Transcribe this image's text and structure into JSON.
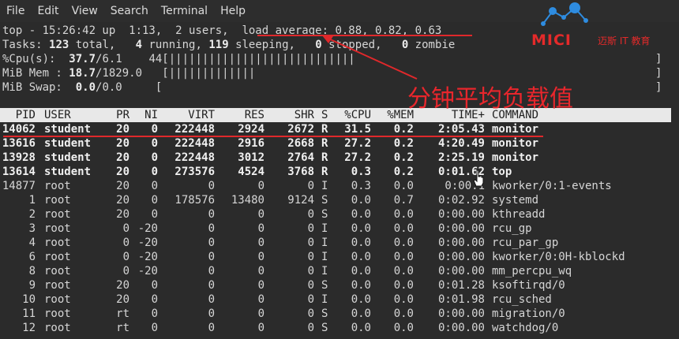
{
  "menu": [
    "File",
    "Edit",
    "View",
    "Search",
    "Terminal",
    "Help"
  ],
  "summary": {
    "top_prefix": "top - 15:26:42 up  1:13,  2 users,  ",
    "load_average": "load average: 0.88, 0.82, 0.63",
    "tasks_label": "Tasks: ",
    "tasks_total": "123",
    "tasks_total_label": " total,   ",
    "tasks_running": "4",
    "tasks_running_label": " running, ",
    "tasks_sleeping": "119",
    "tasks_sleeping_label": " sleeping,   ",
    "tasks_stopped": "0",
    "tasks_stopped_label": " stopped,   ",
    "tasks_zombie": "0",
    "tasks_zombie_label": " zombie",
    "cpu_label": "%Cpu(s):  ",
    "cpu_value": "37.7",
    "cpu_rest": "/6.1    44[||||||||||||||||||||||||||||",
    "mem_label": "MiB Mem : ",
    "mem_value": "18.7",
    "mem_rest": "/1829.0   [|||||||||||||",
    "swap_label": "MiB Swap:  ",
    "swap_value": "0.0",
    "swap_rest": "/0.0     [",
    "bracket": "]"
  },
  "columns": [
    "PID",
    "USER",
    "PR",
    "NI",
    "VIRT",
    "RES",
    "SHR",
    "S",
    "%CPU",
    "%MEM",
    "TIME+",
    "COMMAND"
  ],
  "processes": [
    {
      "pid": "14062",
      "user": "student",
      "pr": "20",
      "ni": "0",
      "virt": "222448",
      "res": "2924",
      "shr": "2672",
      "s": "R",
      "cpu": "31.5",
      "mem": "0.2",
      "time": "2:05.43",
      "cmd": "monitor",
      "bold": true
    },
    {
      "pid": "13616",
      "user": "student",
      "pr": "20",
      "ni": "0",
      "virt": "222448",
      "res": "2916",
      "shr": "2668",
      "s": "R",
      "cpu": "27.2",
      "mem": "0.2",
      "time": "4:20.49",
      "cmd": "monitor",
      "bold": true
    },
    {
      "pid": "13928",
      "user": "student",
      "pr": "20",
      "ni": "0",
      "virt": "222448",
      "res": "3012",
      "shr": "2764",
      "s": "R",
      "cpu": "27.2",
      "mem": "0.2",
      "time": "2:25.19",
      "cmd": "monitor",
      "bold": true
    },
    {
      "pid": "13614",
      "user": "student",
      "pr": "20",
      "ni": "0",
      "virt": "273576",
      "res": "4524",
      "shr": "3768",
      "s": "R",
      "cpu": "0.3",
      "mem": "0.2",
      "time": "0:01.62",
      "cmd": "top",
      "bold": true
    },
    {
      "pid": "14877",
      "user": "root",
      "pr": "20",
      "ni": "0",
      "virt": "0",
      "res": "0",
      "shr": "0",
      "s": "I",
      "cpu": "0.3",
      "mem": "0.0",
      "time": "0:00.1",
      "cmd": "kworker/0:1-events",
      "bold": false
    },
    {
      "pid": "1",
      "user": "root",
      "pr": "20",
      "ni": "0",
      "virt": "178576",
      "res": "13480",
      "shr": "9124",
      "s": "S",
      "cpu": "0.0",
      "mem": "0.7",
      "time": "0:02.92",
      "cmd": "systemd",
      "bold": false
    },
    {
      "pid": "2",
      "user": "root",
      "pr": "20",
      "ni": "0",
      "virt": "0",
      "res": "0",
      "shr": "0",
      "s": "S",
      "cpu": "0.0",
      "mem": "0.0",
      "time": "0:00.00",
      "cmd": "kthreadd",
      "bold": false
    },
    {
      "pid": "3",
      "user": "root",
      "pr": "0",
      "ni": "-20",
      "virt": "0",
      "res": "0",
      "shr": "0",
      "s": "I",
      "cpu": "0.0",
      "mem": "0.0",
      "time": "0:00.00",
      "cmd": "rcu_gp",
      "bold": false
    },
    {
      "pid": "4",
      "user": "root",
      "pr": "0",
      "ni": "-20",
      "virt": "0",
      "res": "0",
      "shr": "0",
      "s": "I",
      "cpu": "0.0",
      "mem": "0.0",
      "time": "0:00.00",
      "cmd": "rcu_par_gp",
      "bold": false
    },
    {
      "pid": "6",
      "user": "root",
      "pr": "0",
      "ni": "-20",
      "virt": "0",
      "res": "0",
      "shr": "0",
      "s": "I",
      "cpu": "0.0",
      "mem": "0.0",
      "time": "0:00.00",
      "cmd": "kworker/0:0H-kblockd",
      "bold": false
    },
    {
      "pid": "8",
      "user": "root",
      "pr": "0",
      "ni": "-20",
      "virt": "0",
      "res": "0",
      "shr": "0",
      "s": "I",
      "cpu": "0.0",
      "mem": "0.0",
      "time": "0:00.00",
      "cmd": "mm_percpu_wq",
      "bold": false
    },
    {
      "pid": "9",
      "user": "root",
      "pr": "20",
      "ni": "0",
      "virt": "0",
      "res": "0",
      "shr": "0",
      "s": "S",
      "cpu": "0.0",
      "mem": "0.0",
      "time": "0:01.28",
      "cmd": "ksoftirqd/0",
      "bold": false
    },
    {
      "pid": "10",
      "user": "root",
      "pr": "20",
      "ni": "0",
      "virt": "0",
      "res": "0",
      "shr": "0",
      "s": "I",
      "cpu": "0.0",
      "mem": "0.0",
      "time": "0:01.98",
      "cmd": "rcu_sched",
      "bold": false
    },
    {
      "pid": "11",
      "user": "root",
      "pr": "rt",
      "ni": "0",
      "virt": "0",
      "res": "0",
      "shr": "0",
      "s": "S",
      "cpu": "0.0",
      "mem": "0.0",
      "time": "0:00.00",
      "cmd": "migration/0",
      "bold": false
    },
    {
      "pid": "12",
      "user": "root",
      "pr": "rt",
      "ni": "0",
      "virt": "0",
      "res": "0",
      "shr": "0",
      "s": "S",
      "cpu": "0.0",
      "mem": "0.0",
      "time": "0:00.00",
      "cmd": "watchdog/0",
      "bold": false
    }
  ],
  "annotation": {
    "text": "分钟平均负载值",
    "color": "#e0282b"
  },
  "logo": {
    "name": "MICI",
    "subtitle": "迈斯 IT 教育",
    "color": "#e42a2a",
    "node_color": "#2e8ce0"
  },
  "colors": {
    "terminal_bg": "#2b2b2b",
    "menubar_bg": "#2d2d2d",
    "header_bg": "#e8e8e8"
  }
}
